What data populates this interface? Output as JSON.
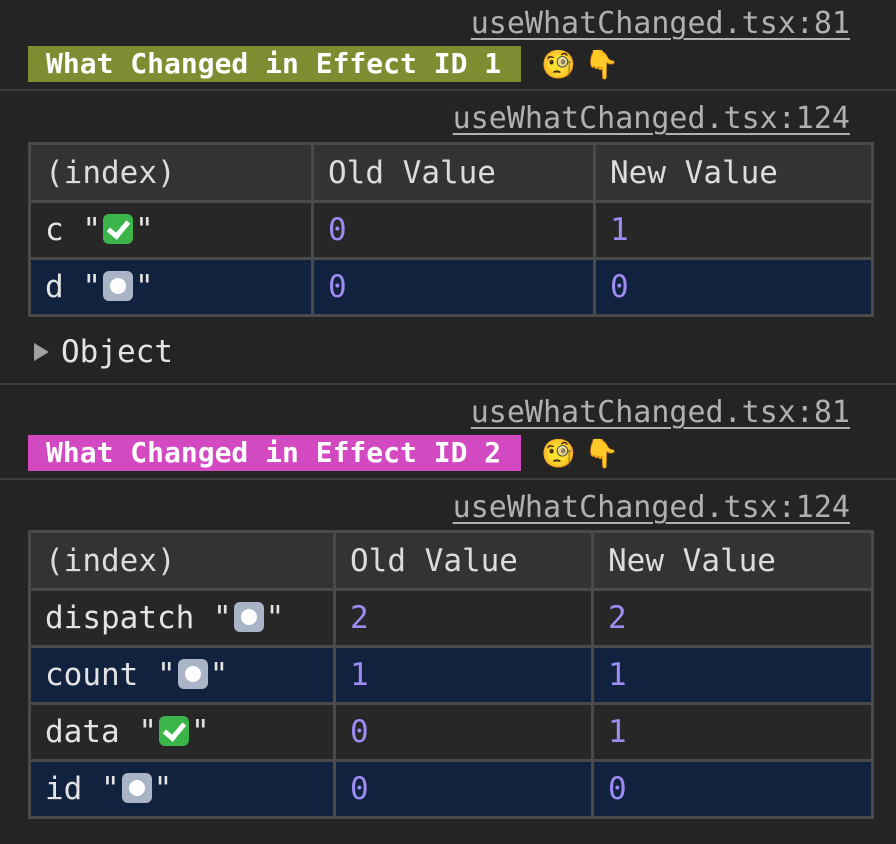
{
  "group1": {
    "source_link": "useWhatChanged.tsx:81",
    "badge_label": "What Changed in Effect ID 1",
    "badge_color": "#7d8e32",
    "emoji_1": "🧐",
    "emoji_2": "👇"
  },
  "table1": {
    "source_link": "useWhatChanged.tsx:124",
    "headers": [
      "(index)",
      "Old Value",
      "New Value"
    ],
    "rows": [
      {
        "name": "c",
        "mark": "check-icon",
        "old": "0",
        "new": "1"
      },
      {
        "name": "d",
        "mark": "radio-icon",
        "old": "0",
        "new": "0"
      }
    ],
    "object_label": "Object"
  },
  "group2": {
    "source_link": "useWhatChanged.tsx:81",
    "badge_label": "What Changed in Effect ID 2",
    "badge_color": "#d349c2",
    "emoji_1": "🧐",
    "emoji_2": "👇"
  },
  "table2": {
    "source_link": "useWhatChanged.tsx:124",
    "headers": [
      "(index)",
      "Old Value",
      "New Value"
    ],
    "rows": [
      {
        "name": "dispatch",
        "mark": "radio-icon",
        "old": "2",
        "new": "2"
      },
      {
        "name": "count",
        "mark": "radio-icon",
        "old": "1",
        "new": "1"
      },
      {
        "name": "data",
        "mark": "check-icon",
        "old": "0",
        "new": "1"
      },
      {
        "name": "id",
        "mark": "radio-icon",
        "old": "0",
        "new": "0"
      }
    ]
  },
  "quote_char": "\""
}
